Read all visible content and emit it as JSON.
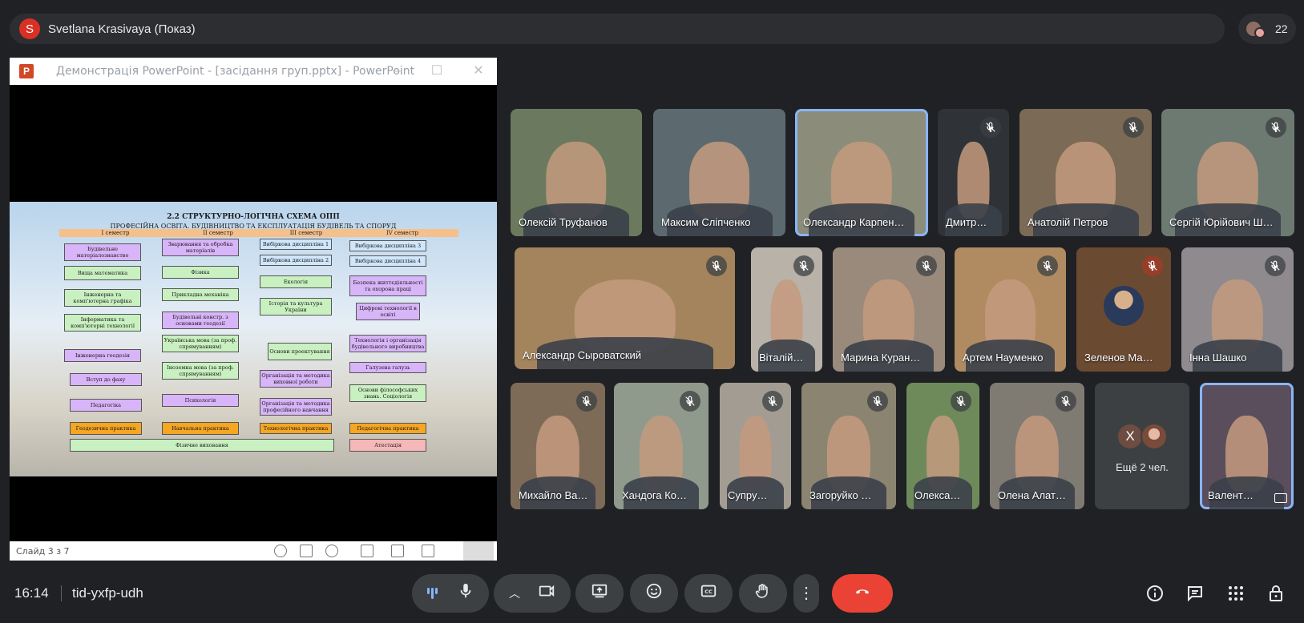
{
  "presenter": {
    "initial": "S",
    "name": "Svetlana Krasivaya (Показ)"
  },
  "participants_count": "22",
  "powerpoint": {
    "title": "Демонстрація PowerPoint - [засідання груп.pptx] - PowerPoint",
    "slide_counter": "Слайд 3 з 7",
    "slide": {
      "title": "2.2 СТРУКТУРНО-ЛОГІЧНА СХЕМА ОПП",
      "subtitle": "ПРОФЕСІЙНА ОСВІТА. БУДІВНИЦТВО ТА ЕКСПЛУАТАЦІЯ БУДІВЕЛЬ ТА СПОРУД",
      "semesters": [
        "I семестр",
        "II семестр",
        "III семестр",
        "IV семестр"
      ],
      "boxes": [
        "Будівельне матеріалознавство",
        "Вища математика",
        "Інженерна та комп'ютерна графіка",
        "Інформатика та комп'ютерні технології",
        "Інженерна геодезія",
        "Вступ до фаху",
        "Педагогіка",
        "Геодезична практика",
        "Зварювання та обробка матеріалів",
        "Фізика",
        "Прикладна механіка",
        "Будівельні констр. з основами геодезії",
        "Українська мова (за проф. спрямуванням)",
        "Іноземна мова (за проф. спрямуванням)",
        "Психологія",
        "Навчальна практика",
        "Вибіркова дисципліна 1",
        "Вибіркова дисципліна 2",
        "Екологія",
        "Історія та культура України",
        "Основи проектування",
        "Організація та методика виховної роботи",
        "Організація та методика професійного навчання",
        "Технологічна практика",
        "Вибіркова дисципліна 3",
        "Вибіркова дисципліна 4",
        "Безпека життєдіяльності та охорона праці",
        "Цифрові технології в освіті",
        "Технологія і організація будівельного виробництва",
        "Галузева галузь",
        "Основи філософських знань. Соціологія",
        "Педагогічна практика",
        "Атестація",
        "Фізичне виховання"
      ]
    }
  },
  "tiles": [
    {
      "name": "Олексій Труфанов",
      "muted": false,
      "speaking": false,
      "bg": "#6b7a5e"
    },
    {
      "name": "Максим Сліпченко",
      "muted": false,
      "speaking": false,
      "bg": "#5c6a70"
    },
    {
      "name": "Олександр Карпен…",
      "muted": false,
      "speaking": true,
      "bg": "#8b8d7a"
    },
    {
      "name": "Дмитр…",
      "muted": true,
      "speaking": false,
      "bg": "#2f3338"
    },
    {
      "name": "Анатолій Петров",
      "muted": true,
      "speaking": false,
      "bg": "#7b6a55"
    },
    {
      "name": "Сергій Юрійович Ш…",
      "muted": true,
      "speaking": false,
      "bg": "#6d7a72"
    },
    {
      "name": "Александр Сыроватский",
      "muted": true,
      "speaking": false,
      "bg": "#a4845c"
    },
    {
      "name": "Віталій…",
      "muted": true,
      "speaking": false,
      "bg": "#b8b2a8"
    },
    {
      "name": "Марина Куран…",
      "muted": true,
      "speaking": false,
      "bg": "#9a8a7c"
    },
    {
      "name": "Артем Науменко",
      "muted": true,
      "speaking": false,
      "bg": "#b08b62"
    },
    {
      "name": "Зеленов Ма…",
      "muted": true,
      "speaking": false,
      "bg": "#6b4a32"
    },
    {
      "name": "Інна Шашко",
      "muted": true,
      "speaking": false,
      "bg": "#8e8a8e"
    },
    {
      "name": "Михайло Ва…",
      "muted": true,
      "speaking": false,
      "bg": "#7d6b58"
    },
    {
      "name": "Хандога Ко…",
      "muted": true,
      "speaking": false,
      "bg": "#8f9a8c"
    },
    {
      "name": "Супру…",
      "muted": true,
      "speaking": false,
      "bg": "#a39c92"
    },
    {
      "name": "Загоруйко …",
      "muted": true,
      "speaking": false,
      "bg": "#8a8470"
    },
    {
      "name": "Олекса…",
      "muted": true,
      "speaking": false,
      "bg": "#6f8a5a"
    },
    {
      "name": "Олена Алат…",
      "muted": true,
      "speaking": false,
      "bg": "#7f7a72"
    },
    {
      "name": "Валент…",
      "muted": false,
      "speaking": false,
      "bg": "#5a4e5c"
    }
  ],
  "more": {
    "initial": "X",
    "label": "Ещё 2 чел."
  },
  "bottom": {
    "time": "16:14",
    "meeting_code": "tid-yxfp-udh"
  },
  "icons": {
    "mic": "mic-icon",
    "camera": "camera-icon",
    "present": "present-icon",
    "emoji": "emoji-icon",
    "captions": "captions-icon",
    "hand": "raise-hand-icon",
    "more": "more-vert-icon",
    "hangup": "hangup-icon",
    "info": "info-icon",
    "chat": "chat-icon",
    "activities": "apps-icon",
    "host": "host-controls-icon"
  },
  "colors": {
    "background": "#202124",
    "surface": "#3c4043",
    "hangup": "#ea4335",
    "speaking_outline": "#8ab4f8"
  }
}
